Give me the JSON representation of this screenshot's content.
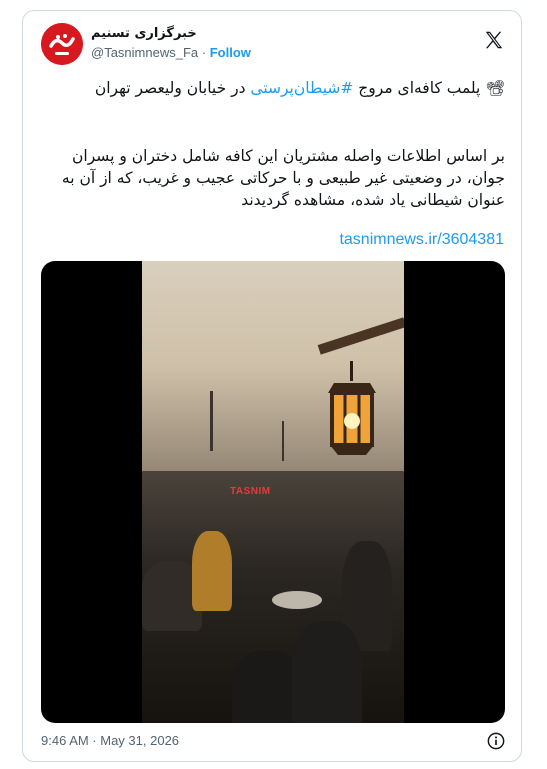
{
  "account": {
    "display_name": "خبرگزاری تسنیم",
    "handle": "@Tasnimnews_Fa",
    "separator": "·",
    "follow_label": "Follow",
    "avatar_icon": "tasnim-logo-icon",
    "brand_color": "#d7191f"
  },
  "tweet": {
    "line1_prefix": "پلمب کافه‌ای مروج ",
    "hashtag": "#شیطان‌پرستی",
    "line1_suffix": " در خیابان ولیعصر تهران",
    "body": "بر اساس اطلاعات واصله مشتریان این کافه شامل دختران و پسران جوان، در وضعیتی غیر طبیعی و با حرکاتی عجیب و غریب، که از آن به عنوان شیطانی یاد شده، مشاهده گردیدند",
    "link": "tasnimnews.ir/3604381",
    "media_emoji": "📽",
    "video_watermark": "TASNIM"
  },
  "meta": {
    "timestamp": "9:46 AM · May 31, 2026"
  },
  "colors": {
    "link": "#1d9bf0",
    "muted": "#536471",
    "text": "#0f1419"
  }
}
